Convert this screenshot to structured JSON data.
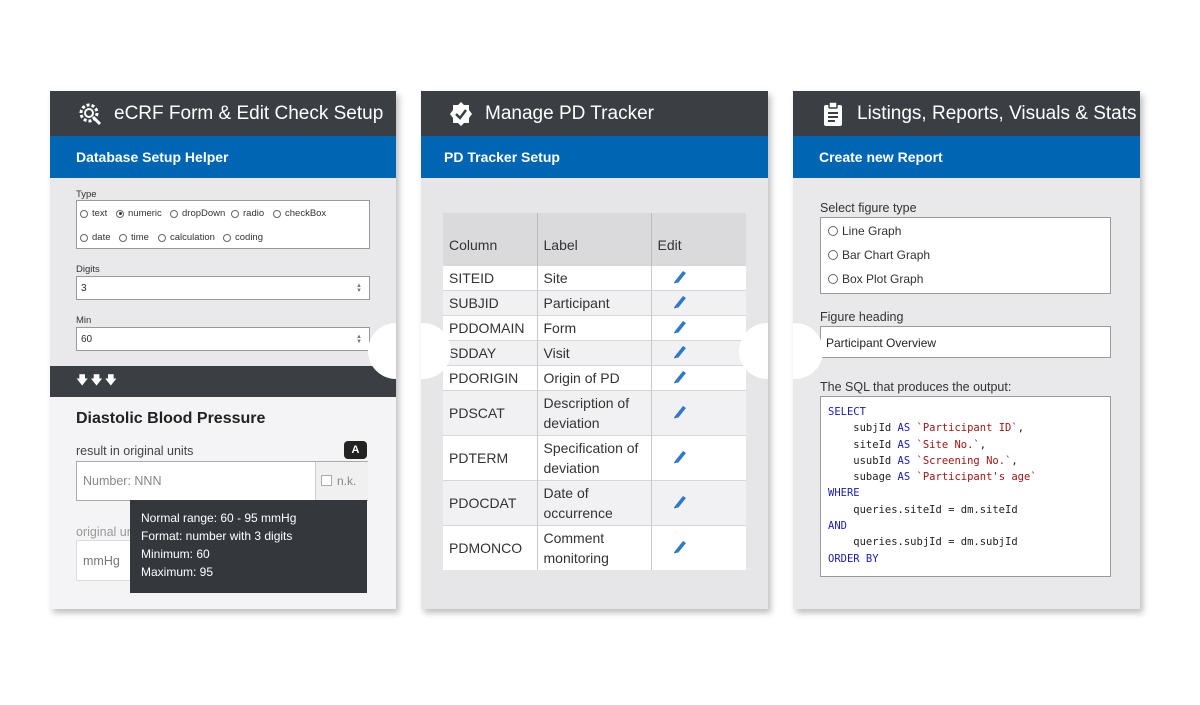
{
  "panel1": {
    "title": "eCRF Form & Edit Check Setup",
    "icon": "gear-search-icon",
    "subtitle": "Database Setup Helper",
    "type_label": "Type",
    "type_options": [
      "text",
      "numeric",
      "dropDown",
      "radio",
      "checkBox",
      "date",
      "time",
      "calculation",
      "coding"
    ],
    "type_selected": "numeric",
    "digits_label": "Digits",
    "digits_value": "3",
    "min_label": "Min",
    "min_value": "60",
    "arrows": "🡇🡇🡇",
    "form_title": "Diastolic Blood Pressure",
    "result_label": "result in original units",
    "badge": "A",
    "number_placeholder": "Number: NNN",
    "nk_label": "n.k.",
    "original_units_label": "original units",
    "unit_value": "mmHg",
    "tooltip": [
      "Normal range: 60 - 95 mmHg",
      "Format: number with 3 digits",
      "Minimum: 60",
      "Maximum: 95"
    ]
  },
  "panel2": {
    "title": "Manage PD Tracker",
    "icon": "badge-check-icon",
    "subtitle": "PD Tracker Setup",
    "columns": [
      "Column",
      "Label",
      "Edit"
    ],
    "rows": [
      {
        "column": "SITEID",
        "label": [
          "Site"
        ]
      },
      {
        "column": "SUBJID",
        "label": [
          "Participant"
        ]
      },
      {
        "column": "PDDOMAIN",
        "label": [
          "Form"
        ]
      },
      {
        "column": "SDDAY",
        "label": [
          "Visit"
        ]
      },
      {
        "column": "PDORIGIN",
        "label": [
          "Origin of PD"
        ]
      },
      {
        "column": "PDSCAT",
        "label": [
          "Description of",
          "deviation"
        ]
      },
      {
        "column": "PDTERM",
        "label": [
          "Specification of",
          "deviation"
        ]
      },
      {
        "column": "PDOCDAT",
        "label": [
          "Date of",
          "occurrence"
        ]
      },
      {
        "column": "PDMONCO",
        "label": [
          "Comment",
          "monitoring"
        ]
      }
    ]
  },
  "panel3": {
    "title": "Listings, Reports, Visuals & Stats",
    "icon": "clipboard-icon",
    "subtitle": "Create new Report",
    "figure_type_label": "Select figure type",
    "figure_types": [
      "Line Graph",
      "Bar Chart Graph",
      "Box Plot Graph"
    ],
    "heading_label": "Figure heading",
    "heading_value": "Participant Overview",
    "sql_label": "The SQL that produces the output:",
    "sql_lines": [
      [
        {
          "k": "kw",
          "t": "SELECT"
        }
      ],
      [
        {
          "k": "",
          "t": "    subjId "
        },
        {
          "k": "kw",
          "t": "AS"
        },
        {
          "k": "",
          "t": " "
        },
        {
          "k": "str",
          "t": "`Participant ID`"
        },
        {
          "k": "",
          "t": ","
        }
      ],
      [
        {
          "k": "",
          "t": "    siteId "
        },
        {
          "k": "kw",
          "t": "AS"
        },
        {
          "k": "",
          "t": " "
        },
        {
          "k": "str",
          "t": "`Site No.`"
        },
        {
          "k": "",
          "t": ","
        }
      ],
      [
        {
          "k": "",
          "t": "    usubId "
        },
        {
          "k": "kw",
          "t": "AS"
        },
        {
          "k": "",
          "t": " "
        },
        {
          "k": "str",
          "t": "`Screening No.`"
        },
        {
          "k": "",
          "t": ","
        }
      ],
      [
        {
          "k": "",
          "t": "    subage "
        },
        {
          "k": "kw",
          "t": "AS"
        },
        {
          "k": "",
          "t": " "
        },
        {
          "k": "str",
          "t": "`Participant's age`"
        }
      ],
      [
        {
          "k": "kw",
          "t": "WHERE"
        }
      ],
      [
        {
          "k": "",
          "t": "    queries.siteId = dm.siteId"
        }
      ],
      [
        {
          "k": "kw",
          "t": "AND"
        }
      ],
      [
        {
          "k": "",
          "t": "    queries.subjId = dm.subjId"
        }
      ],
      [
        {
          "k": "kw",
          "t": "ORDER BY"
        }
      ]
    ]
  },
  "colors": {
    "header": "#3b3f44",
    "accent": "#0066b3",
    "panel": "#e9e9ec"
  }
}
